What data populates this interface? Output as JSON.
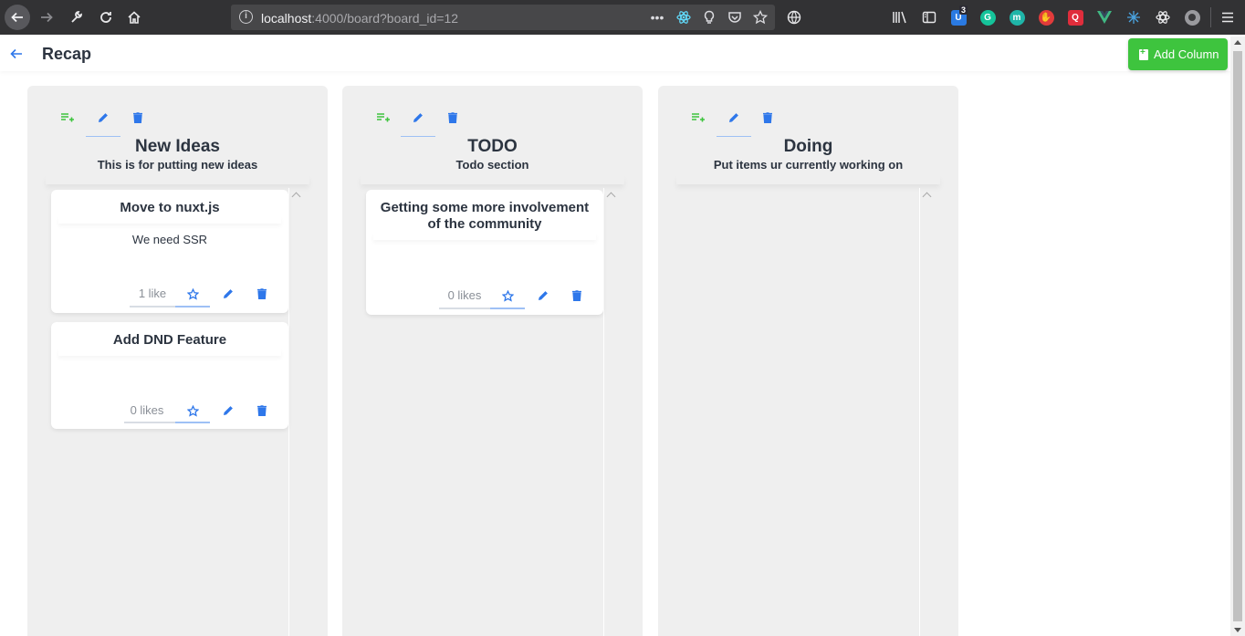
{
  "browser": {
    "url_host": "localhost",
    "url_rest": ":4000/board?board_id=12",
    "extension_badge": "3"
  },
  "header": {
    "title": "Recap",
    "add_column_label": "Add Column"
  },
  "columns": [
    {
      "title": "New Ideas",
      "subtitle": "This is for putting new ideas",
      "cards": [
        {
          "title": "Move to nuxt.js",
          "body": "We need SSR",
          "likes": "1 like"
        },
        {
          "title": "Add DND Feature",
          "body": "",
          "likes": "0 likes"
        }
      ]
    },
    {
      "title": "TODO",
      "subtitle": "Todo section",
      "cards": [
        {
          "title": "Getting some more involvement of the community",
          "body": "",
          "likes": "0 likes"
        }
      ]
    },
    {
      "title": "Doing",
      "subtitle": "Put items ur currently working on",
      "cards": []
    }
  ],
  "colors": {
    "accent_blue": "#2e77ea",
    "accent_green": "#3ec43e",
    "column_bg": "#efefef"
  },
  "icons": {
    "column_actions": [
      "playlist-add-icon",
      "pencil-icon",
      "trash-icon"
    ],
    "card_actions": [
      "star-outline-icon",
      "pencil-icon",
      "trash-icon"
    ]
  }
}
